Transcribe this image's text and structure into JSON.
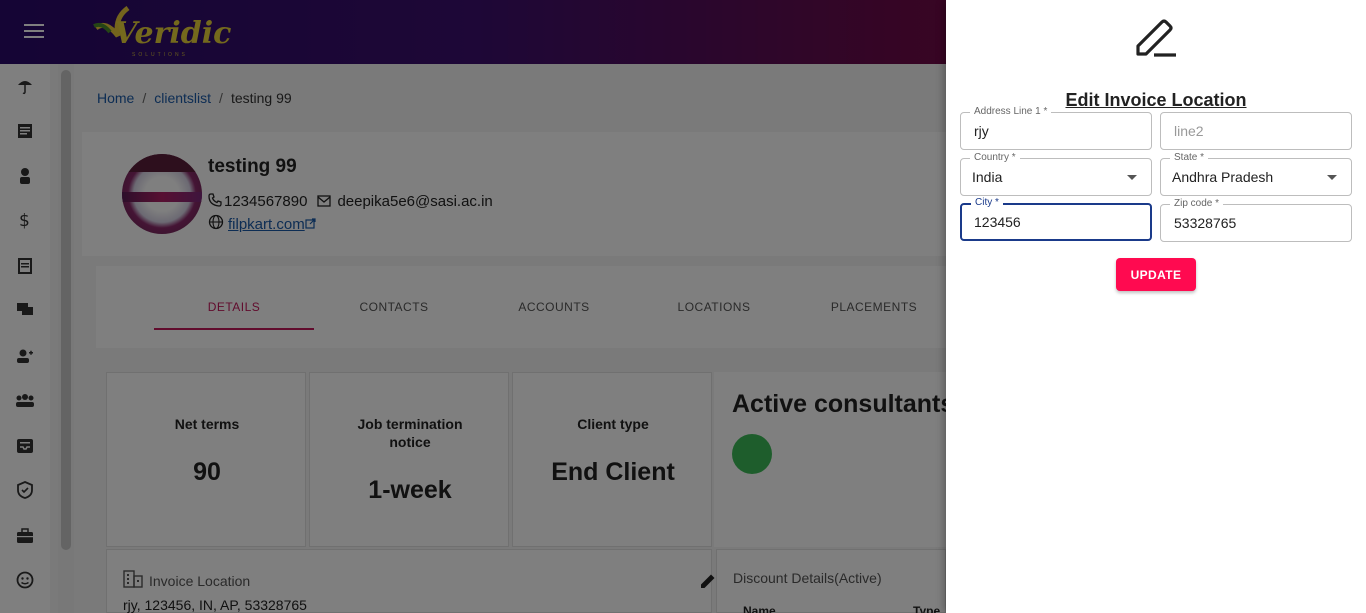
{
  "app": {
    "logo_text": "Veridic",
    "logo_sub": "SOLUTIONS"
  },
  "sidebar": {
    "items": [
      {
        "icon": "umbrella-icon"
      },
      {
        "icon": "document-icon"
      },
      {
        "icon": "person-badge-icon"
      },
      {
        "icon": "dollar-icon"
      },
      {
        "icon": "notepad-icon"
      },
      {
        "icon": "chat-icon"
      },
      {
        "icon": "add-user-icon"
      },
      {
        "icon": "group-icon"
      },
      {
        "icon": "inbox-icon"
      },
      {
        "icon": "shield-icon"
      },
      {
        "icon": "briefcase-icon"
      },
      {
        "icon": "face-icon"
      }
    ]
  },
  "breadcrumb": {
    "home": "Home",
    "clientslist": "clientslist",
    "current": "testing 99",
    "separator": "/"
  },
  "profile": {
    "name": "testing 99",
    "phone": "1234567890",
    "email": "deepika5e6@sasi.ac.in",
    "website": "filpkart.com"
  },
  "tabs": [
    {
      "label": "DETAILS",
      "active": true
    },
    {
      "label": "CONTACTS",
      "active": false
    },
    {
      "label": "ACCOUNTS",
      "active": false
    },
    {
      "label": "LOCATIONS",
      "active": false
    },
    {
      "label": "PLACEMENTS",
      "active": false
    }
  ],
  "stats": [
    {
      "label": "Net terms",
      "value": "90"
    },
    {
      "label": "Job termination notice",
      "value": "1-week"
    },
    {
      "label": "Client type",
      "value": "End Client"
    }
  ],
  "consultants": {
    "title": "Active consultants ("
  },
  "invoice": {
    "title": "Invoice Location",
    "address": "rjy, 123456, IN, AP, 53328765"
  },
  "discount": {
    "title": "Discount Details(Active)",
    "col_name": "Name",
    "col_type": "Type"
  },
  "drawer": {
    "title": "Edit Invoice Location",
    "address1": {
      "label": "Address Line 1 *",
      "value": "rjy"
    },
    "address2": {
      "placeholder": "line2",
      "value": ""
    },
    "country": {
      "label": "Country *",
      "value": "India"
    },
    "state": {
      "label": "State *",
      "value": "Andhra Pradesh"
    },
    "city": {
      "label": "City *",
      "value": "123456"
    },
    "zip": {
      "label": "Zip code *",
      "value": "53328765"
    },
    "update_label": "UPDATE"
  },
  "colors": {
    "accent": "#c2185b",
    "button": "#ff0a50",
    "focus": "#1a3a8a",
    "link": "#1a5aa8",
    "status_green": "#3dbb58"
  }
}
